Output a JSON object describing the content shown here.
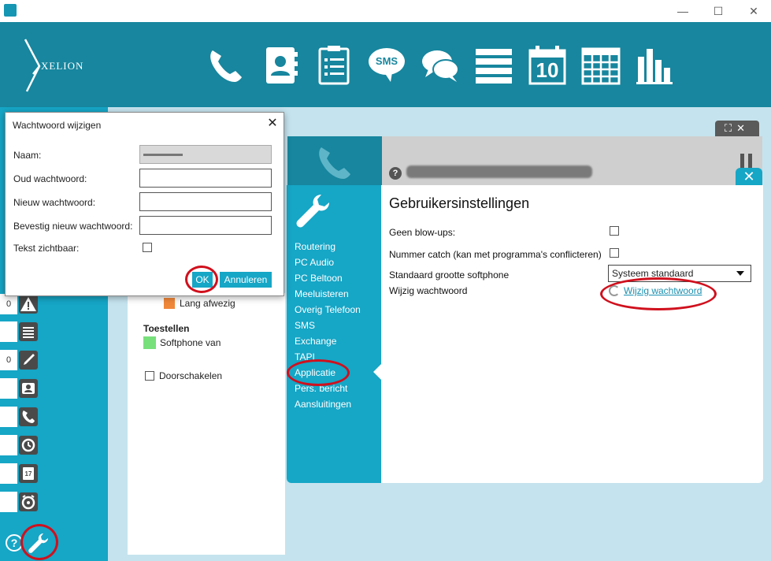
{
  "window": {
    "minimize": "—",
    "maximize": "☐",
    "close": "✕"
  },
  "brand": {
    "name": "XELION"
  },
  "nav": {
    "icons": [
      "phone-icon",
      "contacts-icon",
      "document-icon",
      "sms-icon",
      "chat-icon",
      "list-icon",
      "calendar-icon",
      "grid-icon",
      "stats-icon"
    ],
    "calendar_day": "10",
    "sms_label": "SMS"
  },
  "sidebar": {
    "rows": [
      {
        "count": "0",
        "icon": "warning-icon"
      },
      {
        "count": "",
        "icon": "list-icon"
      },
      {
        "count": "0",
        "icon": "pen-icon"
      },
      {
        "count": "",
        "icon": "contact-card-icon"
      },
      {
        "count": "",
        "icon": "phone-icon"
      },
      {
        "count": "",
        "icon": "history-icon"
      },
      {
        "count": "",
        "icon": "calendar-icon"
      },
      {
        "count": "",
        "icon": "alarm-icon"
      }
    ],
    "calendar_day": "17",
    "help": "?"
  },
  "status_panel": {
    "status_item": "Lang afwezig",
    "devices_heading": "Toestellen",
    "device_item": "Softphone van",
    "forward_label": "Doorschakelen"
  },
  "call_header": {
    "help": "?"
  },
  "settings_menu": {
    "items": [
      "Routering",
      "PC Audio",
      "PC Beltoon",
      "Meeluisteren",
      "Overig Telefoon",
      "SMS",
      "Exchange",
      "TAPI",
      "Applicatie",
      "Pers. bericht",
      "Aansluitingen"
    ],
    "active": "Applicatie"
  },
  "settings_content": {
    "title": "Gebruikersinstellingen",
    "blowups_label": "Geen blow-ups:",
    "number_catch_label": "Nummer catch (kan met programma's conflicteren)",
    "softphone_size_label": "Standaard grootte softphone",
    "softphone_size_value": "Systeem standaard",
    "change_password_label": "Wijzig wachtwoord",
    "change_password_link": "Wijzig wachtwoord"
  },
  "dialog": {
    "title": "Wachtwoord wijzigen",
    "close": "✕",
    "name_label": "Naam:",
    "name_value": "▬▬▬▬▬",
    "old_password_label": "Oud wachtwoord:",
    "new_password_label": "Nieuw wachtwoord:",
    "confirm_password_label": "Bevestig nieuw wachtwoord:",
    "show_text_label": "Tekst zichtbaar:",
    "ok_label": "OK",
    "cancel_label": "Annuleren"
  },
  "colors": {
    "header": "#17869e",
    "accent": "#16a6c6",
    "highlight": "#d0101d",
    "background": "#c5e3ee"
  }
}
